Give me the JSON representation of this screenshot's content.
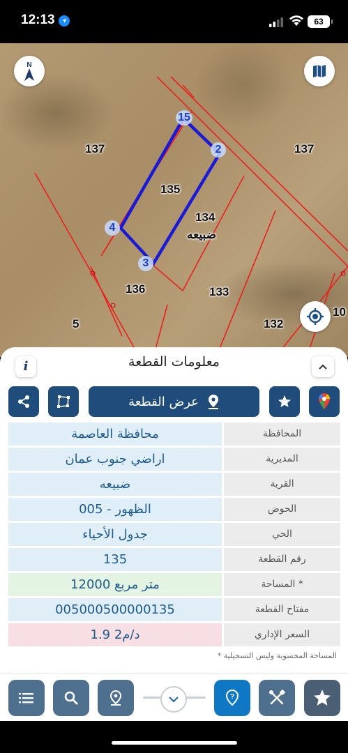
{
  "status": {
    "time": "12:13",
    "battery": "63"
  },
  "map": {
    "parcels": [
      {
        "label": "137"
      },
      {
        "label": "137"
      },
      {
        "label": "135"
      },
      {
        "label": "134"
      },
      {
        "label": "ضبيعه"
      },
      {
        "label": "136"
      },
      {
        "label": "133"
      },
      {
        "label": "5"
      },
      {
        "label": "132"
      },
      {
        "label": "10"
      }
    ],
    "vertices": [
      "15",
      "2",
      "4",
      "3"
    ],
    "compass": "N",
    "colors": {
      "boundary": "#e8221f",
      "selected": "#1a1ad6"
    }
  },
  "panel": {
    "title": "معلومات القطعة",
    "info_label": "i",
    "show_parcel_label": "عرض القطعة",
    "rows": [
      {
        "label": "المحافظة",
        "value": "محافظة العاصمة"
      },
      {
        "label": "المديرية",
        "value": "اراضي جنوب عمان"
      },
      {
        "label": "القرية",
        "value": "ضبيعه"
      },
      {
        "label": "الحوض",
        "value": "الظهور - 005"
      },
      {
        "label": "الحي",
        "value": "جدول الأحياء"
      },
      {
        "label": "رقم القطعة",
        "value": "135"
      },
      {
        "label": "المساحة *",
        "value": "12000  متر مربع"
      },
      {
        "label": "مفتاح القطعة",
        "value": "005000500000135"
      },
      {
        "label": "السعر الإداري",
        "value": "1.9 د/م2"
      }
    ],
    "note": "* المساحة المحسوبة وليس التسجيلية"
  },
  "toolbar": {
    "icons": [
      "list-icon",
      "search-icon",
      "location-pin-icon",
      "chevron-down-icon",
      "help-icon",
      "tools-icon",
      "star-icon"
    ]
  }
}
